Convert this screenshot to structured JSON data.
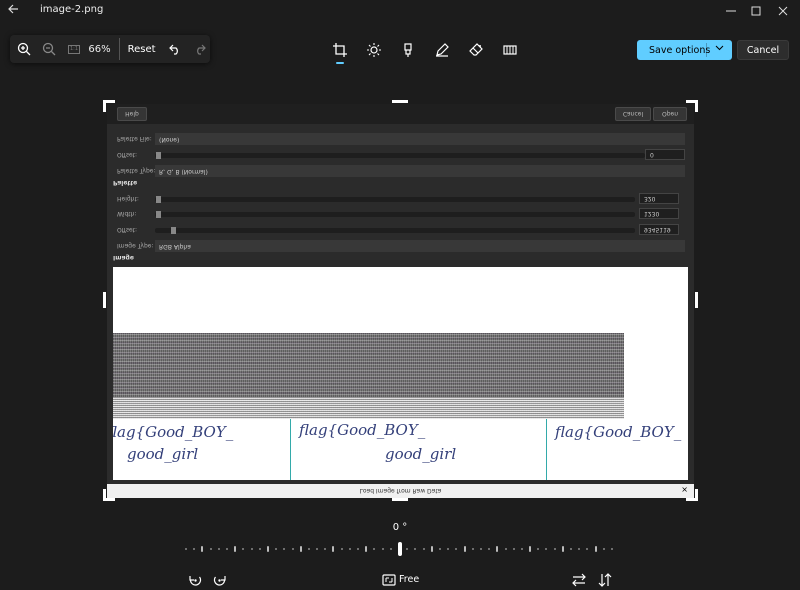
{
  "window": {
    "title": "image-2.png",
    "back_icon": "back-arrow-icon",
    "controls": [
      "minimize-icon",
      "maximize-icon",
      "close-icon"
    ]
  },
  "zoom": {
    "zoom_in_icon": "zoom-in-icon",
    "zoom_out_icon": "zoom-out-icon",
    "actual_size_label": "1:1",
    "value": "66%",
    "reset_label": "Reset",
    "undo_icon": "undo-icon",
    "redo_icon": "redo-icon"
  },
  "tools": [
    {
      "name": "crop-icon",
      "active": true
    },
    {
      "name": "adjust-icon",
      "active": false
    },
    {
      "name": "markup-icon",
      "active": false
    },
    {
      "name": "pen-icon",
      "active": false
    },
    {
      "name": "erase-icon",
      "active": false
    },
    {
      "name": "filter-icon",
      "active": false
    }
  ],
  "actions": {
    "save_label": "Save options",
    "cancel_label": "Cancel",
    "accent_color": "#60cdff"
  },
  "image_content": {
    "dialog_buttons": {
      "help": "Help",
      "cancel": "Cancel",
      "open": "Open"
    },
    "palette_file_label": "Palette File:",
    "palette_file_value": "(None)",
    "palette_offset_label": "Offset:",
    "palette_offset_value": "0",
    "palette_type_label": "Palette Type:",
    "palette_type_value": "R, G, B (Normal)",
    "palette_section": "Palette",
    "height_label": "Height:",
    "height_value": "320",
    "width_label": "Width:",
    "width_value": "1230",
    "image_offset_label": "Offset:",
    "image_offset_value": "9345119",
    "image_type_label": "Image Type:",
    "image_type_value": "RGB Alpha",
    "image_section": "Image",
    "handwriting_1": "flag{Good_BOY_",
    "handwriting_2": "good_girl",
    "dialog_title": "Load Image from Raw Data"
  },
  "rotation": {
    "angle": "0 °"
  },
  "bottom": {
    "rotate_left_icon": "rotate-left-icon",
    "rotate_right_icon": "rotate-right-icon",
    "aspect_icon": "aspect-ratio-icon",
    "aspect_label": "Free",
    "flip_horizontal_icon": "flip-horizontal-icon",
    "flip_vertical_icon": "flip-vertical-icon"
  }
}
